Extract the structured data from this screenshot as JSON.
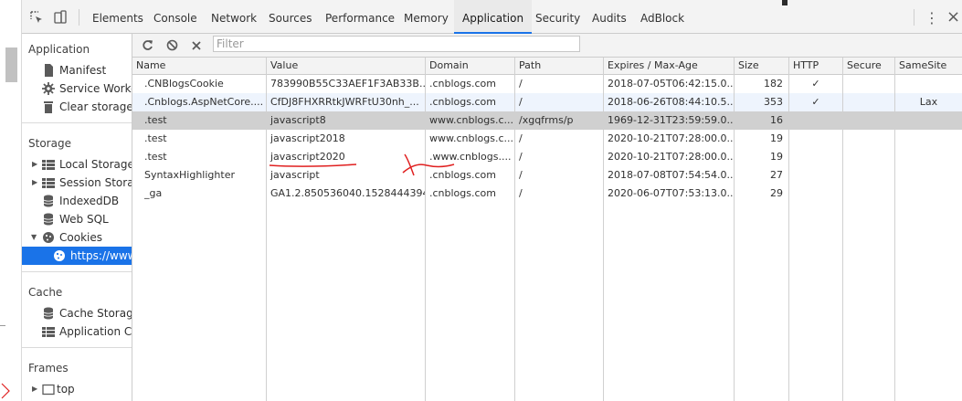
{
  "devtools": {
    "tabs": [
      "Elements",
      "Console",
      "Network",
      "Sources",
      "Performance",
      "Memory",
      "Application",
      "Security",
      "Audits",
      "AdBlock"
    ],
    "active_tab": "Application",
    "icons": {
      "inspect": "inspect-element-icon",
      "device": "device-toggle-icon",
      "more": "more-vert-icon",
      "close": "close-icon"
    }
  },
  "sidebar": {
    "application": {
      "title": "Application",
      "items": [
        {
          "label": "Manifest",
          "icon": "file-icon"
        },
        {
          "label": "Service Workers",
          "icon": "gear-icon"
        },
        {
          "label": "Clear storage",
          "icon": "trash-icon"
        }
      ]
    },
    "storage": {
      "title": "Storage",
      "items": [
        {
          "label": "Local Storage",
          "icon": "grid-icon",
          "expand": true
        },
        {
          "label": "Session Storage",
          "icon": "grid-icon",
          "expand": true
        },
        {
          "label": "IndexedDB",
          "icon": "database-icon"
        },
        {
          "label": "Web SQL",
          "icon": "database-icon"
        },
        {
          "label": "Cookies",
          "icon": "cookie-icon",
          "expanded": true
        },
        {
          "label": "https://www.cnblogs.com",
          "icon": "cookie-icon",
          "selected": true
        }
      ]
    },
    "cache": {
      "title": "Cache",
      "items": [
        {
          "label": "Cache Storage",
          "icon": "database-icon"
        },
        {
          "label": "Application Cache",
          "icon": "grid-icon"
        }
      ]
    },
    "frames": {
      "title": "Frames",
      "items": [
        {
          "label": "top",
          "icon": "frame-icon",
          "expand": true
        }
      ]
    }
  },
  "toolbar": {
    "filter_placeholder": "Filter",
    "icons": [
      "refresh-icon",
      "block-icon",
      "clear-icon"
    ]
  },
  "cookies": {
    "columns": [
      "Name",
      "Value",
      "Domain",
      "Path",
      "Expires / Max-Age",
      "Size",
      "HTTP",
      "Secure",
      "SameSite"
    ],
    "rows": [
      {
        "name": ".CNBlogsCookie",
        "value": "783990B55C33AEF1F3AB33B...",
        "domain": ".cnblogs.com",
        "path": "/",
        "expires": "2018-07-05T06:42:15.0...",
        "size": "182",
        "http": "✓",
        "secure": "",
        "samesite": ""
      },
      {
        "name": ".Cnblogs.AspNetCore....",
        "value": "CfDJ8FHXRRtkJWRFtU30nh_...",
        "domain": ".cnblogs.com",
        "path": "/",
        "expires": "2018-06-26T08:44:10.5...",
        "size": "353",
        "http": "✓",
        "secure": "",
        "samesite": "Lax"
      },
      {
        "name": ".test",
        "value": "javascript8",
        "domain": "www.cnblogs.c...",
        "path": "/xgqfrms/p",
        "expires": "1969-12-31T23:59:59.0...",
        "size": "16",
        "http": "",
        "secure": "",
        "samesite": ""
      },
      {
        "name": ".test",
        "value": "javascript2018",
        "domain": "www.cnblogs.c...",
        "path": "/",
        "expires": "2020-10-21T07:28:00.0...",
        "size": "19",
        "http": "",
        "secure": "",
        "samesite": ""
      },
      {
        "name": ".test",
        "value": "javascript2020",
        "domain": ".www.cnblogs....",
        "path": "/",
        "expires": "2020-10-21T07:28:00.0...",
        "size": "19",
        "http": "",
        "secure": "",
        "samesite": ""
      },
      {
        "name": "SyntaxHighlighter",
        "value": "javascript",
        "domain": ".cnblogs.com",
        "path": "/",
        "expires": "2018-07-08T07:54:54.0...",
        "size": "27",
        "http": "",
        "secure": "",
        "samesite": ""
      },
      {
        "name": "_ga",
        "value": "GA1.2.850536040.1528444394",
        "domain": ".cnblogs.com",
        "path": "/",
        "expires": "2020-06-07T07:53:13.0...",
        "size": "29",
        "http": "",
        "secure": "",
        "samesite": ""
      }
    ],
    "selected_row": 2
  }
}
